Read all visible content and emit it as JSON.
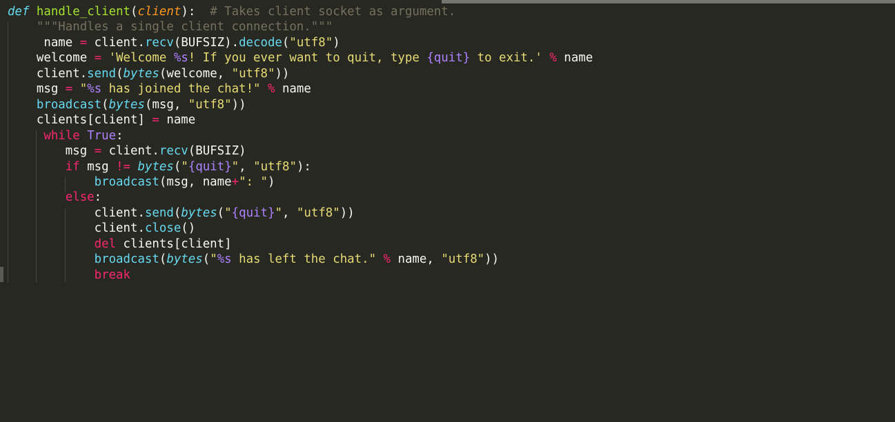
{
  "editor": {
    "colors": {
      "background": "#272822",
      "keyword": "#f92672",
      "string": "#e6db74",
      "function": "#a6e22e",
      "storage": "#66d9ef",
      "parameter": "#fd971f",
      "comment": "#75715e",
      "constant": "#ae81ff",
      "text": "#f8f8f2"
    },
    "lines": [
      [
        {
          "t": "def",
          "c": "kw-storage"
        },
        {
          "t": " "
        },
        {
          "t": "handle_client",
          "c": "fn"
        },
        {
          "t": "("
        },
        {
          "t": "client",
          "c": "param"
        },
        {
          "t": "):  "
        },
        {
          "t": "# Takes client socket as argument.",
          "c": "comment"
        }
      ],
      [
        {
          "t": "    "
        },
        {
          "t": "\"\"\"Handles a single client connection.\"\"\"",
          "c": "comment"
        }
      ],
      [
        {
          "t": "     name "
        },
        {
          "t": "=",
          "c": "op"
        },
        {
          "t": " client."
        },
        {
          "t": "recv",
          "c": "method"
        },
        {
          "t": "(BUFSIZ)."
        },
        {
          "t": "decode",
          "c": "method"
        },
        {
          "t": "("
        },
        {
          "t": "\"utf8\"",
          "c": "str"
        },
        {
          "t": ")"
        }
      ],
      [
        {
          "t": "    welcome "
        },
        {
          "t": "=",
          "c": "op"
        },
        {
          "t": " "
        },
        {
          "t": "'Welcome ",
          "c": "str"
        },
        {
          "t": "%s",
          "c": "fmt"
        },
        {
          "t": "! If you ever want to quit, type ",
          "c": "str"
        },
        {
          "t": "{quit}",
          "c": "fmt"
        },
        {
          "t": " to exit.'",
          "c": "str"
        },
        {
          "t": " "
        },
        {
          "t": "%",
          "c": "op"
        },
        {
          "t": " name"
        }
      ],
      [
        {
          "t": "    client."
        },
        {
          "t": "send",
          "c": "method"
        },
        {
          "t": "("
        },
        {
          "t": "bytes",
          "c": "builtin"
        },
        {
          "t": "(welcome, "
        },
        {
          "t": "\"utf8\"",
          "c": "str"
        },
        {
          "t": "))"
        }
      ],
      [
        {
          "t": "    msg "
        },
        {
          "t": "=",
          "c": "op"
        },
        {
          "t": " "
        },
        {
          "t": "\"",
          "c": "str"
        },
        {
          "t": "%s",
          "c": "fmt"
        },
        {
          "t": " has joined the chat!\"",
          "c": "str"
        },
        {
          "t": " "
        },
        {
          "t": "%",
          "c": "op"
        },
        {
          "t": " name"
        }
      ],
      [
        {
          "t": "    "
        },
        {
          "t": "broadcast",
          "c": "call"
        },
        {
          "t": "("
        },
        {
          "t": "bytes",
          "c": "builtin"
        },
        {
          "t": "(msg, "
        },
        {
          "t": "\"utf8\"",
          "c": "str"
        },
        {
          "t": "))"
        }
      ],
      [
        {
          "t": "    clients[client] "
        },
        {
          "t": "=",
          "c": "op"
        },
        {
          "t": " name"
        }
      ],
      [
        {
          "t": "     "
        },
        {
          "t": "while",
          "c": "kw"
        },
        {
          "t": " "
        },
        {
          "t": "True",
          "c": "const"
        },
        {
          "t": ":"
        }
      ],
      [
        {
          "t": "        msg "
        },
        {
          "t": "=",
          "c": "op"
        },
        {
          "t": " client."
        },
        {
          "t": "recv",
          "c": "method"
        },
        {
          "t": "(BUFSIZ)"
        }
      ],
      [
        {
          "t": "        "
        },
        {
          "t": "if",
          "c": "kw"
        },
        {
          "t": " msg "
        },
        {
          "t": "!=",
          "c": "op"
        },
        {
          "t": " "
        },
        {
          "t": "bytes",
          "c": "builtin"
        },
        {
          "t": "("
        },
        {
          "t": "\"",
          "c": "str"
        },
        {
          "t": "{quit}",
          "c": "fmt"
        },
        {
          "t": "\"",
          "c": "str"
        },
        {
          "t": ", "
        },
        {
          "t": "\"utf8\"",
          "c": "str"
        },
        {
          "t": "):"
        }
      ],
      [
        {
          "t": "            "
        },
        {
          "t": "broadcast",
          "c": "call"
        },
        {
          "t": "(msg, name"
        },
        {
          "t": "+",
          "c": "op"
        },
        {
          "t": "\": \"",
          "c": "str"
        },
        {
          "t": ")"
        }
      ],
      [
        {
          "t": "        "
        },
        {
          "t": "else",
          "c": "kw"
        },
        {
          "t": ":"
        }
      ],
      [
        {
          "t": "            client."
        },
        {
          "t": "send",
          "c": "method"
        },
        {
          "t": "("
        },
        {
          "t": "bytes",
          "c": "builtin"
        },
        {
          "t": "("
        },
        {
          "t": "\"",
          "c": "str"
        },
        {
          "t": "{quit}",
          "c": "fmt"
        },
        {
          "t": "\"",
          "c": "str"
        },
        {
          "t": ", "
        },
        {
          "t": "\"utf8\"",
          "c": "str"
        },
        {
          "t": "))"
        }
      ],
      [
        {
          "t": "            client."
        },
        {
          "t": "close",
          "c": "method"
        },
        {
          "t": "()"
        }
      ],
      [
        {
          "t": "            "
        },
        {
          "t": "del",
          "c": "kw"
        },
        {
          "t": " clients[client]"
        }
      ],
      [
        {
          "t": "            "
        },
        {
          "t": "broadcast",
          "c": "call"
        },
        {
          "t": "("
        },
        {
          "t": "bytes",
          "c": "builtin"
        },
        {
          "t": "("
        },
        {
          "t": "\"",
          "c": "str"
        },
        {
          "t": "%s",
          "c": "fmt"
        },
        {
          "t": " has left the chat.\"",
          "c": "str"
        },
        {
          "t": " "
        },
        {
          "t": "%",
          "c": "op"
        },
        {
          "t": " name, "
        },
        {
          "t": "\"utf8\"",
          "c": "str"
        },
        {
          "t": "))"
        }
      ],
      [
        {
          "t": "            "
        },
        {
          "t": "break",
          "c": "kw"
        }
      ]
    ]
  }
}
